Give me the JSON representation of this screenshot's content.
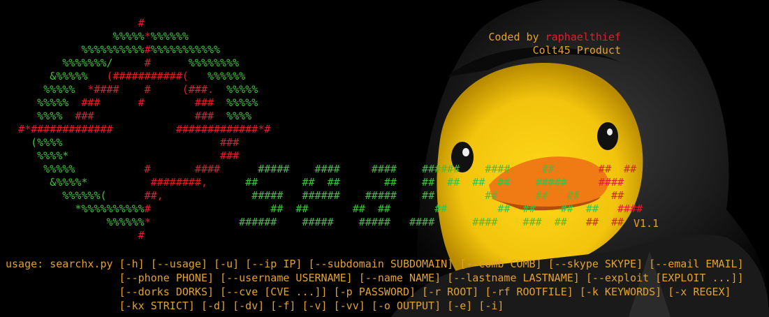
{
  "ascii_art": [
    [
      [
        "r",
        "                     #"
      ]
    ],
    [
      [
        "g",
        "                 %%%%%"
      ],
      [
        "r",
        "*"
      ],
      [
        "g",
        "%%%%%%"
      ]
    ],
    [
      [
        "g",
        "            %%%%%%%%%%"
      ],
      [
        "r",
        "#"
      ],
      [
        "g",
        "%%%%%%%%%%%"
      ]
    ],
    [
      [
        "g",
        "         %%%%%%%/     "
      ],
      [
        "r",
        "#"
      ],
      [
        "g",
        "      %%%%%%%%"
      ]
    ],
    [
      [
        "g",
        "       &%%%%%   "
      ],
      [
        "r",
        "(###########(   "
      ],
      [
        "g",
        "%%%%%%"
      ]
    ],
    [
      [
        "g",
        "      %%%%%  "
      ],
      [
        "r",
        "*####    #     (###.  "
      ],
      [
        "g",
        "%%%%%"
      ]
    ],
    [
      [
        "g",
        "     %%%%%  "
      ],
      [
        "r",
        "###      #        ###  "
      ],
      [
        "g",
        "%%%%%"
      ]
    ],
    [
      [
        "g",
        "     %%%%  "
      ],
      [
        "r",
        "###                ###  "
      ],
      [
        "g",
        "%%%%"
      ]
    ],
    [
      [
        "r",
        "  #*#############          #############*#"
      ]
    ],
    [
      [
        "g",
        "    (%%%%"
      ],
      [
        "r",
        "                         ###"
      ]
    ],
    [
      [
        "g",
        "     %%%%*"
      ],
      [
        "r",
        "                        ###"
      ]
    ],
    [
      [
        "g",
        "      %%%%%"
      ],
      [
        "r",
        "           #       ####"
      ],
      [
        "g",
        "      #####    ####     ####    ######    ####     ##    "
      ],
      [
        "r",
        "   ##  ##"
      ]
    ],
    [
      [
        "g",
        "       &%%%%*"
      ],
      [
        "r",
        "          ########,"
      ],
      [
        "g",
        "      ##       ##  ##       ##    ##  ##  ##  ##    #####  "
      ],
      [
        "r",
        "   ####"
      ]
    ],
    [
      [
        "g",
        "         %%%%%%("
      ],
      [
        "r",
        "      ##,"
      ],
      [
        "g",
        "              #####   ######    #####    ##        ##      ##   ##   "
      ],
      [
        "r",
        "  ##"
      ]
    ],
    [
      [
        "g",
        "           *%%%%%%%%%%"
      ],
      [
        "r",
        "#"
      ],
      [
        "g",
        "                   ##  ##       ##  ##       ##        ##  ##    ##  ##   "
      ],
      [
        "r",
        "####"
      ]
    ],
    [
      [
        "g",
        "                %%%%%%"
      ],
      [
        "r",
        "*"
      ],
      [
        "g",
        "              ######    #####    #####   ####      ####    ###  ##  "
      ],
      [
        "r",
        " ##  ##"
      ]
    ],
    [
      [
        "r",
        "                     #"
      ]
    ]
  ],
  "duck_text": [
    "###",
    "##"
  ],
  "credit": {
    "prefix": "Coded by ",
    "author": "raphaelthief",
    "product": "Colt45 Product"
  },
  "version": "V1.1",
  "usage_lines": [
    "usage: searchx.py [-h] [--usage] [-u] [--ip IP] [--subdomain SUBDOMAIN] [--comb COMB] [--skype SKYPE] [--email EMAIL]",
    "                  [--phone PHONE] [--username USERNAME] [--name NAME] [--lastname LASTNAME] [--exploit [EXPLOIT ...]]",
    "                  [--dorks DORKS] [--cve [CVE ...]] [-p PASSWORD] [-r ROOT] [-rf ROOTFILE] [-k KEYWORDS] [-x REGEX]",
    "                  [-kx STRICT] [-d] [-dv] [-f] [-v] [-vv] [-o OUTPUT] [-e] [-i]"
  ],
  "colors": {
    "green": "#3fc040",
    "red": "#e01e2c",
    "orange": "#e3a12c",
    "duck": "#f2c40d"
  }
}
